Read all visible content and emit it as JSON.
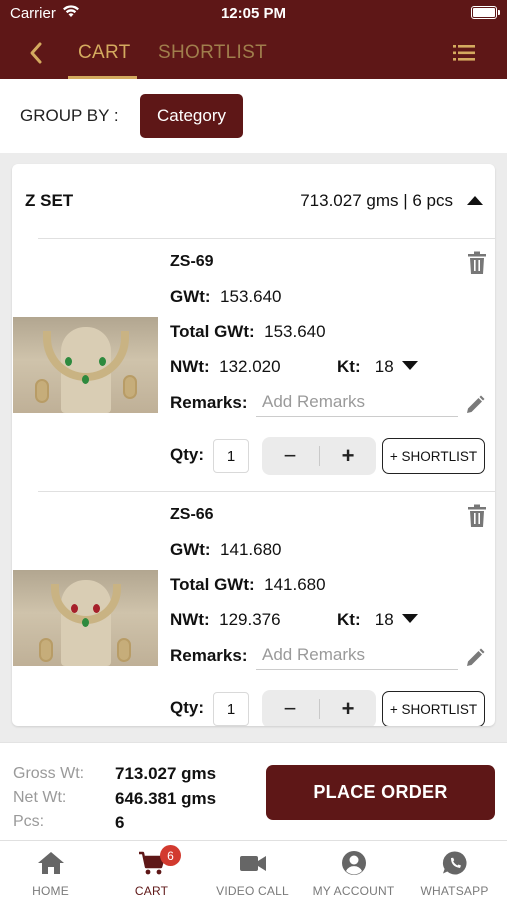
{
  "status_bar": {
    "carrier": "Carrier",
    "time": "12:05 PM"
  },
  "header": {
    "tabs": [
      {
        "label": "CART",
        "active": true
      },
      {
        "label": "SHORTLIST",
        "active": false
      }
    ],
    "back_icon": "chevron-left-icon",
    "menu_icon": "list-menu-icon"
  },
  "group_by": {
    "label": "GROUP BY :",
    "value": "Category"
  },
  "group": {
    "title": "Z SET",
    "summary": "713.027 gms | 6 pcs",
    "expanded": true
  },
  "labels": {
    "gwt": "GWt:",
    "total_gwt": "Total GWt:",
    "nwt": "NWt:",
    "kt": "Kt:",
    "remarks": "Remarks:",
    "remarks_placeholder": "Add Remarks",
    "qty": "Qty:",
    "minus": "−",
    "plus": "+",
    "shortlist": "+ SHORTLIST"
  },
  "items": [
    {
      "code": "ZS-69",
      "gwt": "153.640",
      "total_gwt": "153.640",
      "nwt": "132.020",
      "kt": "18",
      "remarks": "",
      "qty": "1"
    },
    {
      "code": "ZS-66",
      "gwt": "141.680",
      "total_gwt": "141.680",
      "nwt": "129.376",
      "kt": "18",
      "remarks": "",
      "qty": "1"
    }
  ],
  "totals": {
    "gross_label": "Gross Wt:",
    "gross_value": "713.027 gms",
    "net_label": "Net Wt:",
    "net_value": "646.381 gms",
    "pcs_label": "Pcs:",
    "pcs_value": "6"
  },
  "place_order": "PLACE ORDER",
  "tabbar": [
    {
      "label": "HOME",
      "icon": "home-icon",
      "active": false
    },
    {
      "label": "CART",
      "icon": "cart-icon",
      "active": true,
      "badge": "6"
    },
    {
      "label": "VIDEO CALL",
      "icon": "video-camera-icon",
      "active": false
    },
    {
      "label": "MY ACCOUNT",
      "icon": "account-icon",
      "active": false
    },
    {
      "label": "WHATSAPP",
      "icon": "whatsapp-icon",
      "active": false
    }
  ],
  "colors": {
    "brand": "#5e1717",
    "accent_gold": "#d4aa5f",
    "badge": "#d23a2f"
  }
}
